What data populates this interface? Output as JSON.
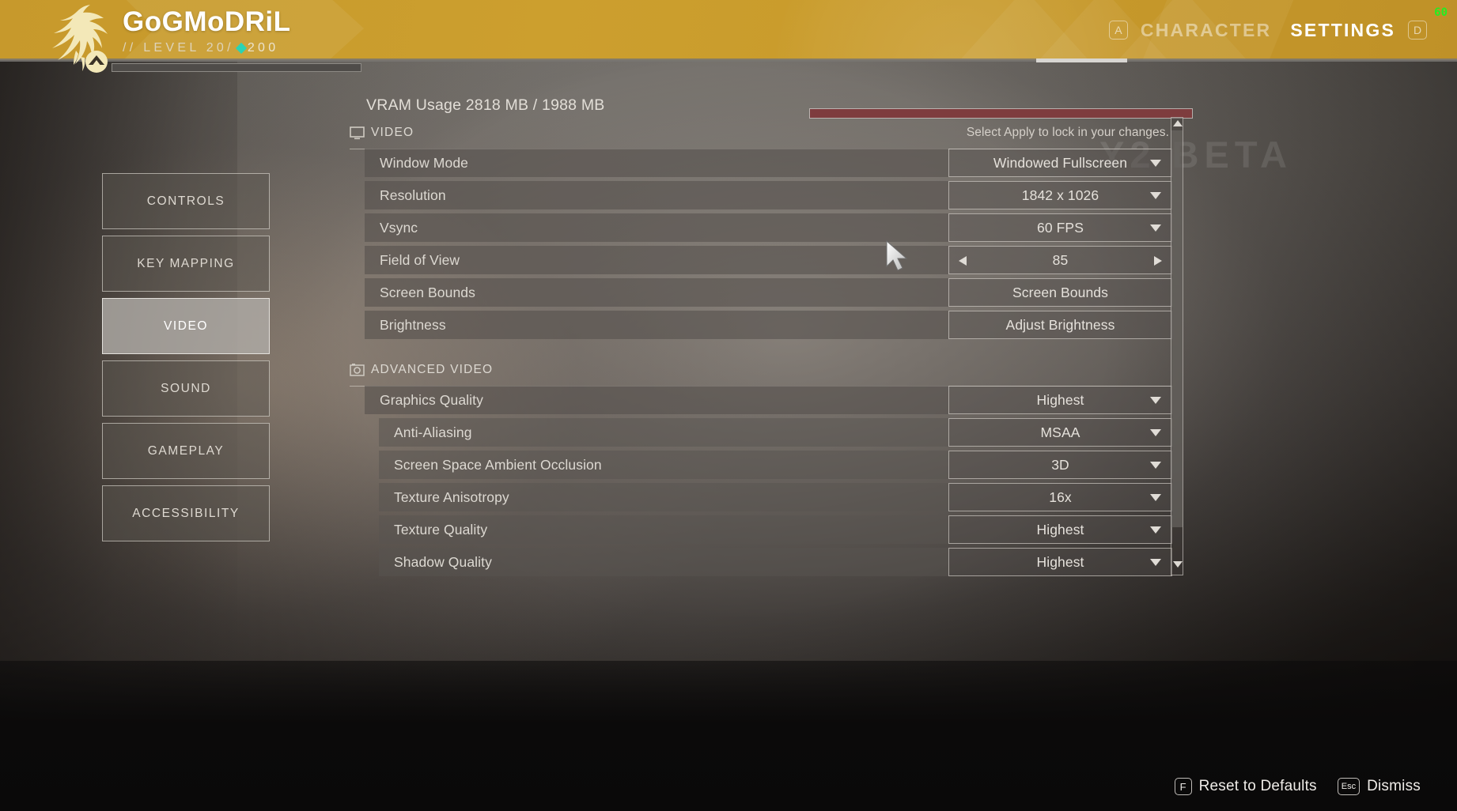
{
  "header": {
    "player_name": "GoGMoDRiL",
    "level_text_prefix": "// LEVEL 20/",
    "level_cap": "200",
    "xp_progress_percent": 0,
    "nav": [
      {
        "key": "A",
        "label": "CHARACTER",
        "active": false
      },
      {
        "key": "D",
        "label": "SETTINGS",
        "active": true
      }
    ],
    "fps_counter": "60",
    "accent_color": "#c89a2b",
    "xp_diamond_color": "#2ad4b4"
  },
  "watermark": "Y2 BETA",
  "sidebar": {
    "items": [
      {
        "label": "CONTROLS",
        "selected": false
      },
      {
        "label": "KEY MAPPING",
        "selected": false
      },
      {
        "label": "VIDEO",
        "selected": true
      },
      {
        "label": "SOUND",
        "selected": false
      },
      {
        "label": "GAMEPLAY",
        "selected": false
      },
      {
        "label": "ACCESSIBILITY",
        "selected": false
      }
    ]
  },
  "vram": {
    "label": "VRAM Usage 2818 MB / 1988 MB",
    "used_mb": 2818,
    "total_mb": 1988,
    "fill_percent": 100,
    "bar_color": "#7e3c3e"
  },
  "sections": [
    {
      "id": "video",
      "icon": "monitor-icon",
      "title": "VIDEO",
      "hint": "Select Apply to lock in your changes.",
      "rows": [
        {
          "name": "Window Mode",
          "value": "Windowed Fullscreen",
          "control": "dropdown",
          "depth": 0
        },
        {
          "name": "Resolution",
          "value": "1842 x 1026",
          "control": "dropdown",
          "depth": 0
        },
        {
          "name": "Vsync",
          "value": "60 FPS",
          "control": "dropdown",
          "depth": 0
        },
        {
          "name": "Field of View",
          "value": "85",
          "control": "stepper",
          "depth": 0
        },
        {
          "name": "Screen Bounds",
          "value": "Screen Bounds",
          "control": "button",
          "depth": 0
        },
        {
          "name": "Brightness",
          "value": "Adjust Brightness",
          "control": "button",
          "depth": 0
        }
      ]
    },
    {
      "id": "advanced-video",
      "icon": "aperture-icon",
      "title": "ADVANCED VIDEO",
      "hint": "",
      "rows": [
        {
          "name": "Graphics Quality",
          "value": "Highest",
          "control": "dropdown",
          "depth": 0
        },
        {
          "name": "Anti-Aliasing",
          "value": "MSAA",
          "control": "dropdown",
          "depth": 1
        },
        {
          "name": "Screen Space Ambient Occlusion",
          "value": "3D",
          "control": "dropdown",
          "depth": 1
        },
        {
          "name": "Texture Anisotropy",
          "value": "16x",
          "control": "dropdown",
          "depth": 1
        },
        {
          "name": "Texture Quality",
          "value": "Highest",
          "control": "dropdown",
          "depth": 1
        },
        {
          "name": "Shadow Quality",
          "value": "Highest",
          "control": "dropdown",
          "depth": 1
        }
      ]
    }
  ],
  "scrollbar": {
    "thumb_percent": 93
  },
  "footer": {
    "items": [
      {
        "key": "F",
        "label": "Reset to Defaults"
      },
      {
        "key": "Esc",
        "label": "Dismiss"
      }
    ]
  }
}
